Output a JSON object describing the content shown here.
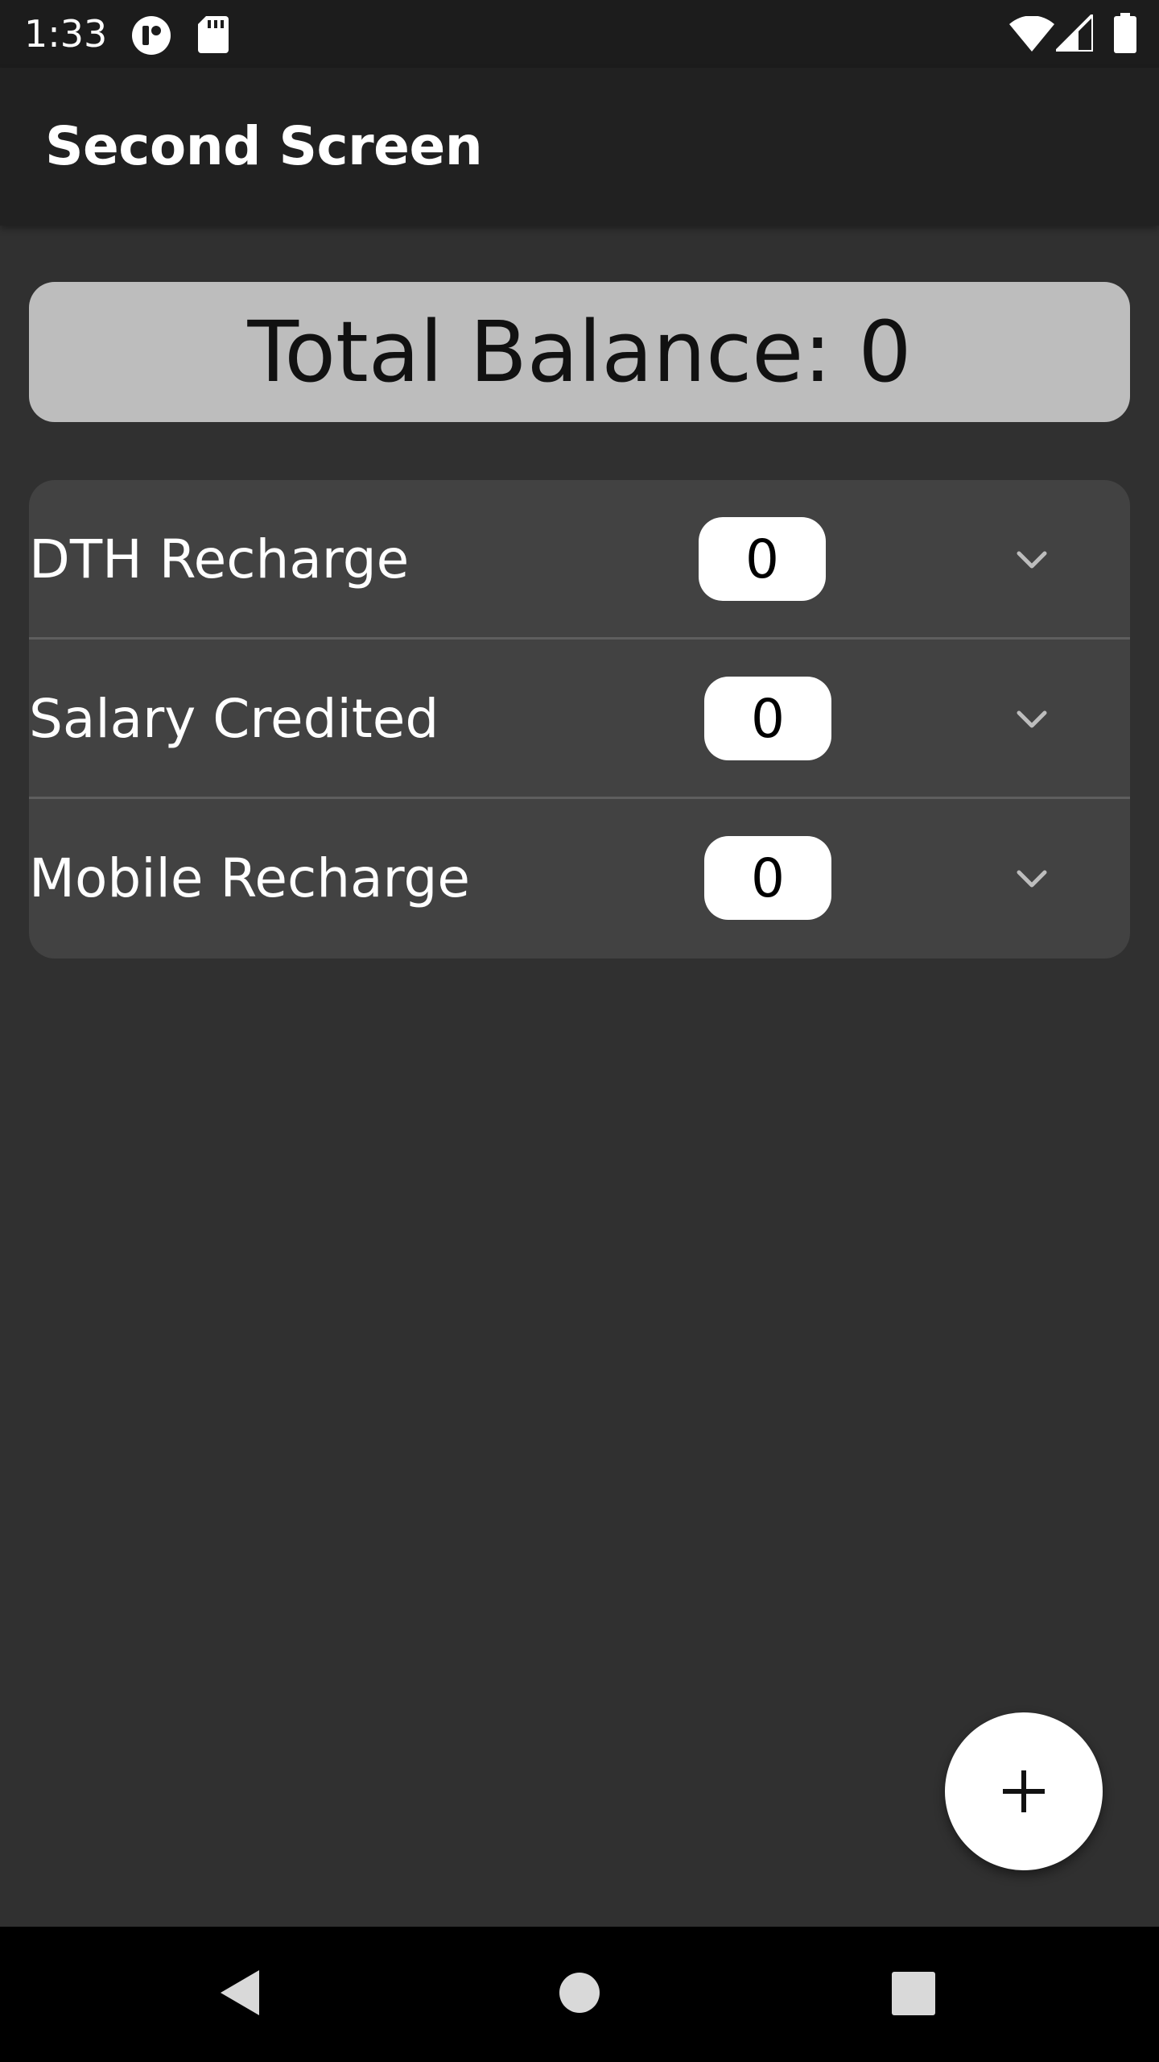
{
  "status_bar": {
    "time": "1:33",
    "icons": [
      "app-notification-icon",
      "sd-card-icon",
      "wifi-icon",
      "cell-signal-icon",
      "battery-icon"
    ]
  },
  "app_bar": {
    "title": "Second Screen"
  },
  "balance": {
    "text": "Total Balance: 0"
  },
  "transactions": [
    {
      "label": "DTH Recharge",
      "amount": "0"
    },
    {
      "label": "Salary Credited",
      "amount": "0"
    },
    {
      "label": "Mobile Recharge",
      "amount": "0"
    }
  ],
  "fab": {
    "icon": "plus-icon"
  },
  "nav_bar": {
    "icons": [
      "back-icon",
      "home-icon",
      "recents-icon"
    ]
  },
  "colors": {
    "background": "#303030",
    "app_bar": "#212121",
    "status_bar": "#1c1c1c",
    "balance_card": "#bdbdbd",
    "list_card": "#424242"
  }
}
